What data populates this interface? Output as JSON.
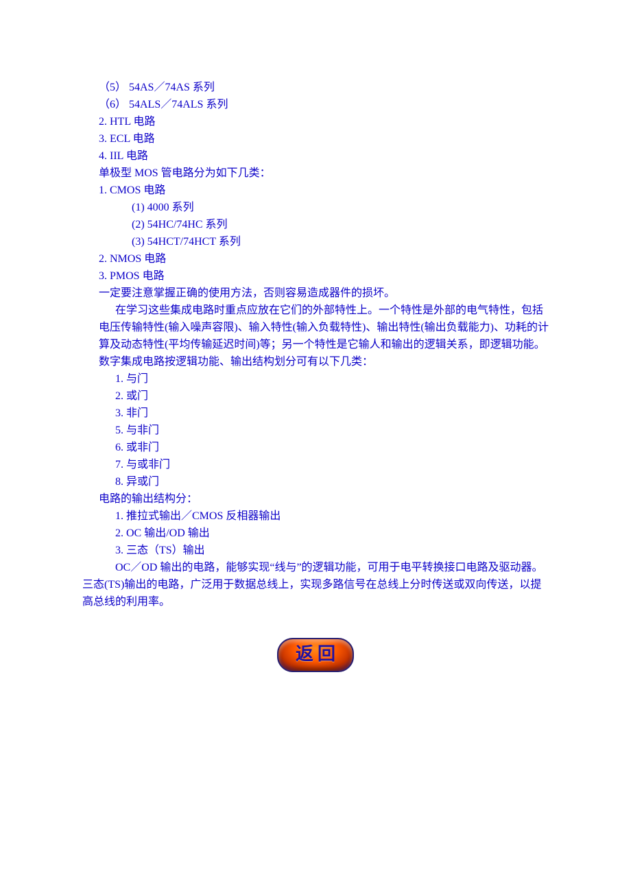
{
  "lines": {
    "l1": "（5）      54AS／74AS 系列",
    "l2": "（6）      54ALS／74ALS 系列",
    "l3": "2.  HTL 电路",
    "l4": "3.  ECL 电路",
    "l5": "4.  IIL 电路",
    "l6": "单极型 MOS 管电路分为如下几类：",
    "l7": "1.  CMOS 电路",
    "l8": "(1)   4000 系列",
    "l9": "(2)   54HC/74HC 系列",
    "l10": "(3)   54HCT/74HCT 系列",
    "l11": "2.  NMOS 电路",
    "l12": "3.  PMOS 电路",
    "l13": "一定要注意掌握正确的使用方法，否则容易造成器件的损坏。",
    "p1": "在学习这些集成电路时重点应放在它们的外部特性上。一个特性是外部的电气特性，包括电压传输特性(输入噪声容限)、输入特性(输入负载特性)、输出特性(输出负载能力)、功耗的计算及动态特性(平均传输延迟时间)等；另一个特性是它输人和输出的逻辑关系，即逻辑功能。数字集成电路按逻辑功能、输出结构划分可有以下几类：",
    "g1": "1.  与门",
    "g2": "2.  或门",
    "g3": "3.  非门",
    "g5": "5.  与非门",
    "g6": "6.  或非门",
    "g7": "7.  与或非门",
    "g8": "8.  异或门",
    "h1": "电路的输出结构分：",
    "o1": "1.  推拉式输出／CMOS 反相器输出",
    "o2": "2.  OC 输出/OD 输出",
    "o3": "3.  三态（TS）输出",
    "p2": " OC／OD 输出的电路，能够实现“线与”的逻辑功能，可用于电平转换接口电路及驱动器。三态(TS)输出的电路，广泛用于数据总线上，实现多路信号在总线上分时传送或双向传送，以提高总线的利用率。",
    "btn": "返回"
  }
}
